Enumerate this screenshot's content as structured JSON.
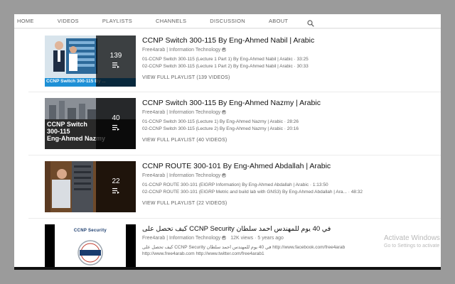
{
  "nav": {
    "tabs": [
      "HOME",
      "VIDEOS",
      "PLAYLISTS",
      "CHANNELS",
      "DISCUSSION",
      "ABOUT"
    ],
    "search_icon": "search-icon"
  },
  "playlists": [
    {
      "title": "CCNP Switch 300-115 By Eng-Ahmed Nabil | Arabic",
      "channel": "Free4arab | Information Technology",
      "count": "139",
      "thumb_caption": "CCNP Switch 300-115 By ...",
      "videos": [
        "01-CCNP Switch 300-115 (Lecture 1 Part 1) By Eng-Ahmed Nabil | Arabic · 33:25",
        "02-CCNP Switch 300-115 (Lecture 1 Part 2) By Eng-Ahmed Nabil | Arabic · 30:33"
      ],
      "view_all": "VIEW FULL PLAYLIST (139 VIDEOS)"
    },
    {
      "title": "CCNP Switch 300-115 By Eng-Ahmed Nazmy | Arabic",
      "channel": "Free4arab | Information Technology",
      "count": "40",
      "thumb_lines": [
        "CCNP Switch",
        "300-115",
        "Eng-Ahmed Nazmy"
      ],
      "videos": [
        "01-CCNP Switch 300-115 (Lecture 1) By Eng-Ahmed Nazmy | Arabic · 28:26",
        "02-CCNP Switch 300-115 (Lecture 2) By Eng-Ahmed Nazmy | Arabic · 20:16"
      ],
      "view_all": "VIEW FULL PLAYLIST (40 VIDEOS)"
    },
    {
      "title": "CCNP ROUTE 300-101 By Eng-Ahmed Abdallah | Arabic",
      "channel": "Free4arab | Information Technology",
      "count": "22",
      "videos": [
        "01-CCNP ROUTE 300-101 (EIGRP Information) By Eng-Ahmed Abdallah | Arabic · 1:13:50",
        "02-CCNP ROUTE 300-101 (EIGRP Metric and build lab with GNS3) By Eng-Ahmed Abdallah | Ara... · 48:32"
      ],
      "view_all": "VIEW FULL PLAYLIST (22 VIDEOS)"
    }
  ],
  "video": {
    "title": "كيف تحصل على CCNP Security في 40 يوم للمهندس احمد سلطان",
    "channel": "Free4arab | Information Technology",
    "views": "12K views",
    "age": "5 years ago",
    "thumb_text": "CCNP Security",
    "desc1": "كيف تحصل على CCNP Security في 40 يوم للمهندس احمد سلطان http://www.facebook.com/free4arab",
    "desc2": "http://www.free4arab.com http://www.twitter.com/free4arab1"
  },
  "watermark": {
    "line1": "Activate Windows",
    "line2": "Go to Settings to activate"
  }
}
